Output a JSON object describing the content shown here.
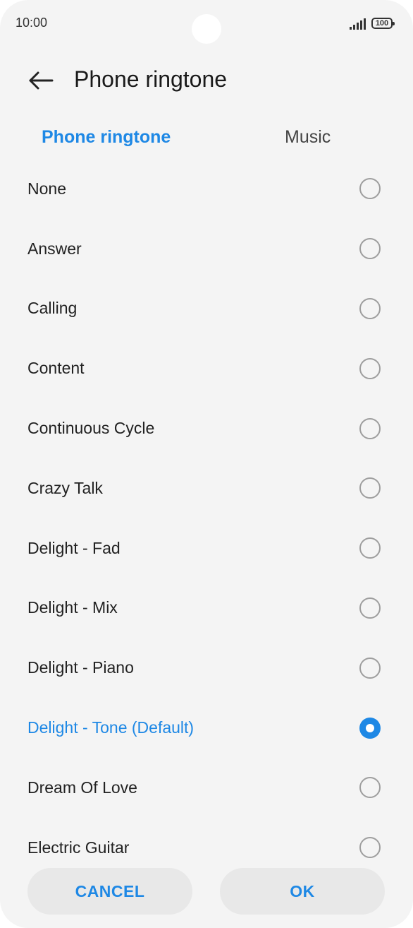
{
  "status_bar": {
    "time": "10:00",
    "battery": "100"
  },
  "header": {
    "title": "Phone ringtone"
  },
  "tabs": [
    {
      "label": "Phone ringtone",
      "active": true
    },
    {
      "label": "Music",
      "active": false
    }
  ],
  "ringtones": [
    {
      "label": "None",
      "selected": false
    },
    {
      "label": "Answer",
      "selected": false
    },
    {
      "label": "Calling",
      "selected": false
    },
    {
      "label": "Content",
      "selected": false
    },
    {
      "label": "Continuous Cycle",
      "selected": false
    },
    {
      "label": "Crazy Talk",
      "selected": false
    },
    {
      "label": "Delight - Fad",
      "selected": false
    },
    {
      "label": "Delight - Mix",
      "selected": false
    },
    {
      "label": "Delight - Piano",
      "selected": false
    },
    {
      "label": "Delight - Tone (Default)",
      "selected": true
    },
    {
      "label": "Dream Of Love",
      "selected": false
    },
    {
      "label": "Electric Guitar",
      "selected": false
    }
  ],
  "buttons": {
    "cancel": "CANCEL",
    "ok": "OK"
  },
  "colors": {
    "accent": "#1e88e5",
    "background": "#f4f4f4"
  }
}
